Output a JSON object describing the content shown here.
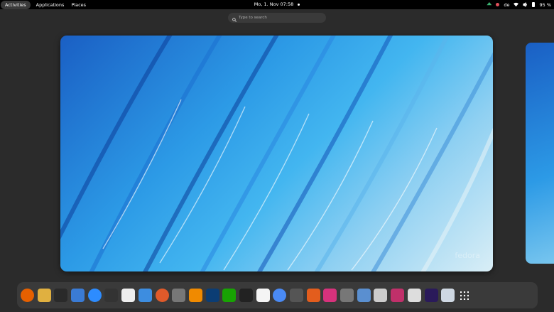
{
  "topbar": {
    "activities": "Activities",
    "applications": "Applications",
    "places": "Places",
    "clock": "Mo, 1. Nov  07:58",
    "keyboard_layout": "de",
    "battery": "95 %"
  },
  "search": {
    "placeholder": "Type to search"
  },
  "workspace": {
    "watermark": "fedora"
  },
  "colors": {
    "panel": "#000000",
    "background": "#2b2b2b",
    "dash": "#3a3a3a",
    "accent": "#2c9ae6"
  },
  "dash": {
    "apps": [
      {
        "name": "firefox-icon",
        "color": "#e66000"
      },
      {
        "name": "gnome-games-icon",
        "color": "#e0b040"
      },
      {
        "name": "terminal-icon",
        "color": "#2a2a2a"
      },
      {
        "name": "mail-client-icon",
        "color": "#3a7bd5"
      },
      {
        "name": "zoom-icon",
        "color": "#2d8cff"
      },
      {
        "name": "system-monitor-icon",
        "color": "#333333"
      },
      {
        "name": "document-viewer-icon",
        "color": "#eeeeee"
      },
      {
        "name": "resource-monitor-icon",
        "color": "#3d8de0"
      },
      {
        "name": "alarm-icon",
        "color": "#e05a2a"
      },
      {
        "name": "settings-icon",
        "color": "#777777"
      },
      {
        "name": "vlc-icon",
        "color": "#f08a00"
      },
      {
        "name": "nextcloud-icon",
        "color": "#0b3d74"
      },
      {
        "name": "spreadsheet-icon",
        "color": "#18a303"
      },
      {
        "name": "inkscape-icon",
        "color": "#222222"
      },
      {
        "name": "latex-editor-icon",
        "color": "#f4f4f4"
      },
      {
        "name": "chromium-icon",
        "color": "#4a8af4"
      },
      {
        "name": "tools-icon",
        "color": "#555555"
      },
      {
        "name": "matlab-icon",
        "color": "#e35d1d"
      },
      {
        "name": "calculator-icon",
        "color": "#d7327c"
      },
      {
        "name": "wrench-icon",
        "color": "#777777"
      },
      {
        "name": "kdenlive-icon",
        "color": "#5a8fd0"
      },
      {
        "name": "disk-utility-icon",
        "color": "#cccccc"
      },
      {
        "name": "screenshot-icon",
        "color": "#c0306a"
      },
      {
        "name": "software-store-icon",
        "color": "#dddddd"
      },
      {
        "name": "astronomy-icon",
        "color": "#2a1a5a"
      },
      {
        "name": "file-manager-icon",
        "color": "#cfd8e3"
      },
      {
        "name": "show-apps-icon",
        "color": "transparent"
      }
    ]
  }
}
